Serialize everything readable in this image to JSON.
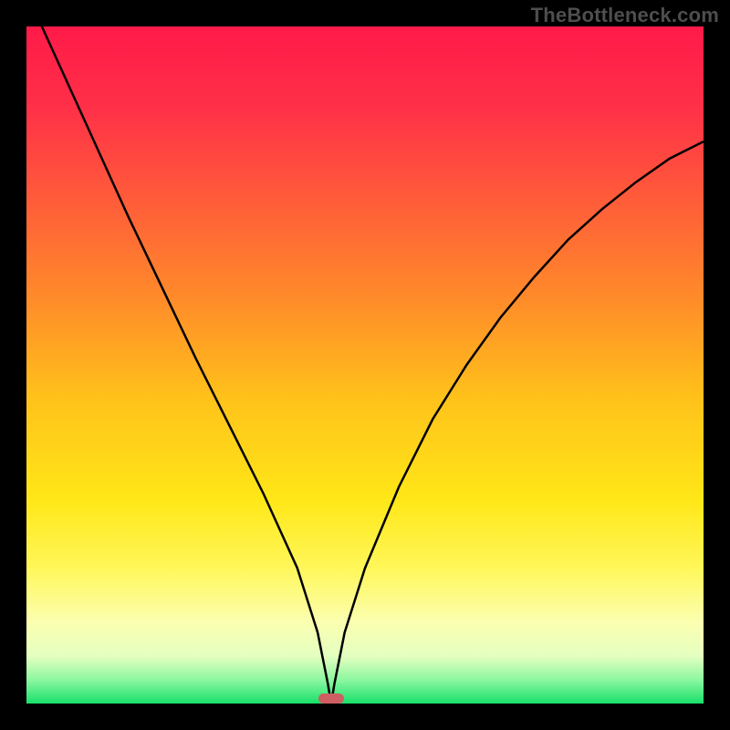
{
  "watermark": "TheBottleneck.com",
  "colors": {
    "gradient_stops": [
      {
        "offset": 0.0,
        "color": "#ff1a49"
      },
      {
        "offset": 0.12,
        "color": "#ff3048"
      },
      {
        "offset": 0.25,
        "color": "#ff5a3a"
      },
      {
        "offset": 0.4,
        "color": "#ff8a2a"
      },
      {
        "offset": 0.55,
        "color": "#ffc21a"
      },
      {
        "offset": 0.7,
        "color": "#ffe718"
      },
      {
        "offset": 0.8,
        "color": "#fff75a"
      },
      {
        "offset": 0.88,
        "color": "#fbffb0"
      },
      {
        "offset": 0.93,
        "color": "#e4ffc0"
      },
      {
        "offset": 0.965,
        "color": "#8cf7a0"
      },
      {
        "offset": 1.0,
        "color": "#18e06a"
      }
    ],
    "curve": "#000000",
    "marker": "#cd5e62",
    "frame": "#000000"
  },
  "chart_data": {
    "type": "line",
    "title": "",
    "xlabel": "",
    "ylabel": "",
    "xlim": [
      0,
      100
    ],
    "ylim": [
      0,
      100
    ],
    "notch_x": 45,
    "series": [
      {
        "name": "bottleneck-curve",
        "x": [
          0,
          5,
          10,
          15,
          20,
          25,
          30,
          35,
          40,
          43,
          44.5,
          45,
          45.5,
          47,
          50,
          55,
          60,
          65,
          70,
          75,
          80,
          85,
          90,
          95,
          100
        ],
        "y": [
          105,
          94,
          83,
          72,
          61.5,
          51,
          41,
          31,
          20,
          10.5,
          3,
          0,
          3,
          10.5,
          20,
          32,
          42,
          50,
          57,
          63,
          68.5,
          73,
          77,
          80.5,
          83
        ]
      }
    ],
    "marker": {
      "x_center": 45,
      "half_width": 1.9,
      "y": 0
    }
  }
}
